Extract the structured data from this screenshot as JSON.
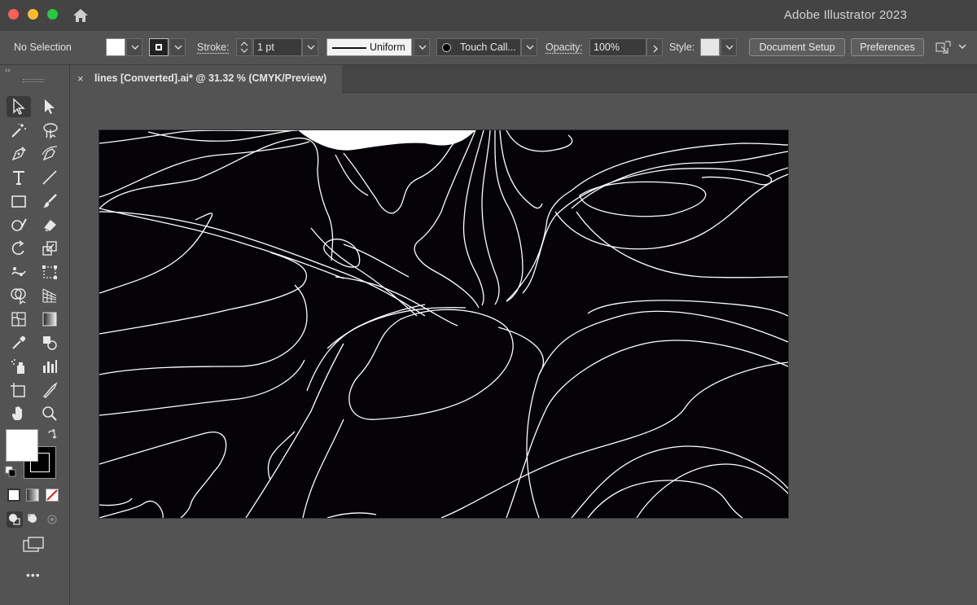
{
  "titlebar": {
    "app_title": "Adobe Illustrator 2023",
    "buttons": [
      "close-window",
      "minimize-window",
      "maximize-window"
    ],
    "home_icon": "home-icon"
  },
  "control_bar": {
    "selection_label": "No Selection",
    "fill_color": "#ffffff",
    "stroke_label": "Stroke:",
    "stroke_weight": "1 pt",
    "variable_width_profile": "Uniform",
    "brush_definition": "Touch Call...",
    "opacity_label": "Opacity:",
    "opacity_value": "100%",
    "style_label": "Style:",
    "document_setup_button": "Document Setup",
    "preferences_button": "Preferences"
  },
  "document_tab": {
    "close_glyph": "×",
    "title": "lines [Converted].ai* @ 31.32 % (CMYK/Preview)"
  },
  "toolbar": {
    "collapse_glyph": "‹‹",
    "more_glyph": "•••",
    "tools": [
      "selection-tool-icon",
      "direct-selection-tool-icon",
      "magic-wand-icon",
      "lasso-icon",
      "pen-tool-icon",
      "curvature-tool-icon",
      "type-tool-icon",
      "line-segment-tool-icon",
      "rectangle-tool-icon",
      "paintbrush-tool-icon",
      "shaper-tool-icon",
      "eraser-tool-icon",
      "rotate-tool-icon",
      "scale-tool-icon",
      "puppet-warp-icon",
      "free-transform-icon",
      "shape-builder-icon",
      "perspective-grid-icon",
      "mesh-tool-icon",
      "gradient-tool-icon",
      "eyedropper-icon",
      "blend-tool-icon",
      "symbol-sprayer-icon",
      "column-graph-icon",
      "artboard-tool-icon",
      "slice-tool-icon",
      "hand-tool-icon",
      "zoom-tool-icon"
    ]
  },
  "artboard": {
    "background": "#050308",
    "line_color": "#ffffff"
  }
}
